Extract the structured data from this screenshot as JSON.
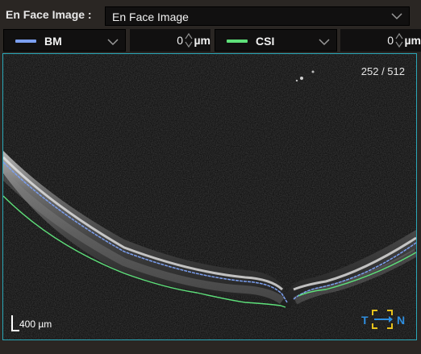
{
  "enface": {
    "label": "En Face Image :",
    "selected": "En Face Image"
  },
  "layers": {
    "top": {
      "name": "BM",
      "color": "#7b9ff0",
      "offset": "0",
      "unit": "µm"
    },
    "bottom": {
      "name": "CSI",
      "color": "#5ee07a",
      "offset": "0",
      "unit": "µm"
    }
  },
  "viewer": {
    "slice_counter": "252 / 512",
    "scale_label": "400 µm",
    "orientation_left": "T",
    "orientation_right": "N",
    "orientation_color": "#2f8fe0",
    "frame_color": "#2aa7b8"
  },
  "icons": [
    "chevron-down-icon",
    "spin-up-icon",
    "spin-down-icon",
    "orientation-arrow-icon"
  ]
}
